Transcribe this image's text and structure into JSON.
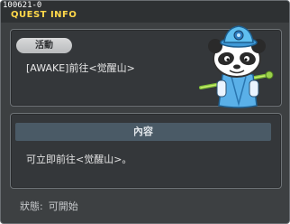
{
  "window": {
    "quest_id": "100621-0",
    "title": "QUEST INFO"
  },
  "quest": {
    "category_badge": "活動",
    "name": "[AWAKE]前往<觉醒山>"
  },
  "content": {
    "header": "內容",
    "description": "可立即前往<觉醒山>。"
  },
  "status": {
    "label": "狀態:",
    "value": "可開始"
  },
  "npc": {
    "icon": "panda-npc-icon"
  },
  "colors": {
    "title_accent": "#ffd84a",
    "content_header_bg": "#4a5a66"
  }
}
